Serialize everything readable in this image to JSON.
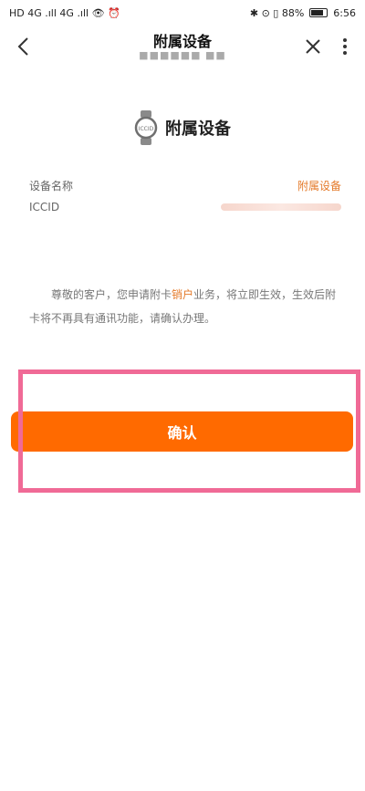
{
  "status_bar": {
    "left_indicators": "HD 4G .ıll 4G .ıll 👁 ⏰",
    "right_indicators": "✱ ⊙ ▯ 88%",
    "time": "6:56"
  },
  "header": {
    "title": "附属设备",
    "subtitle": "■■■■■■ ■■",
    "back_glyph": "〈",
    "close_glyph": "✕",
    "more_glyph": "⋮"
  },
  "device": {
    "heading": "附属设备",
    "icon": "smartwatch-icon"
  },
  "info": {
    "name_label": "设备名称",
    "name_value": "附属设备",
    "iccid_label": "ICCID"
  },
  "notice": {
    "part1": "尊敬的客户，您申请附卡",
    "highlight": "销户",
    "part2": "业务，将立即生效，生效后附卡将不再具有通讯功能，请确认办理。"
  },
  "actions": {
    "confirm_label": "确认"
  },
  "colors": {
    "accent": "#ff6a00",
    "accent_text": "#e47a2a",
    "annotation_box": "#f06a96"
  }
}
